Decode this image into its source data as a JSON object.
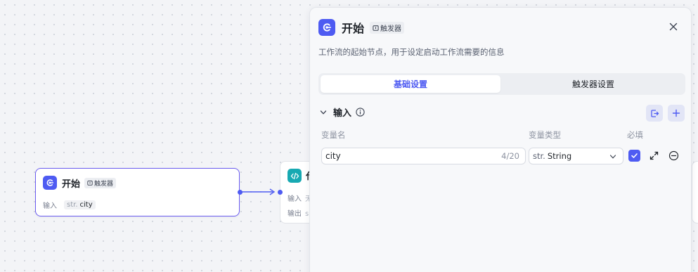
{
  "canvas": {
    "start_node": {
      "title": "开始",
      "badge": "触发器",
      "input_label": "输入",
      "var_type": "str.",
      "var_name": "city"
    },
    "code_node": {
      "title": "代",
      "input_label": "输入",
      "input_value": "无",
      "output_label": "输出",
      "output_value": "s"
    }
  },
  "panel": {
    "title": "开始",
    "badge": "触发器",
    "description": "工作流的起始节点，用于设定启动工作流需要的信息",
    "tabs": [
      {
        "label": "基础设置",
        "active": true
      },
      {
        "label": "触发器设置",
        "active": false
      }
    ],
    "section": {
      "title": "输入",
      "columns": {
        "name": "变量名",
        "type": "变量类型",
        "required": "必填"
      },
      "variables": [
        {
          "name": "city",
          "char_count": "4/20",
          "type_prefix": "str.",
          "type": "String",
          "required": true
        }
      ]
    }
  },
  "colors": {
    "accent": "#4e5bf2",
    "code_node": "#17a9b2",
    "node_border_selected": "#6b5cf0"
  },
  "icons": {
    "app": "start-app-icon",
    "trigger": "trigger-icon",
    "close": "close-icon",
    "collapse": "chevron-down-icon",
    "info": "info-icon",
    "import": "import-icon",
    "add": "plus-icon",
    "expand": "expand-icon",
    "remove": "minus-circle-icon",
    "code": "code-icon"
  }
}
